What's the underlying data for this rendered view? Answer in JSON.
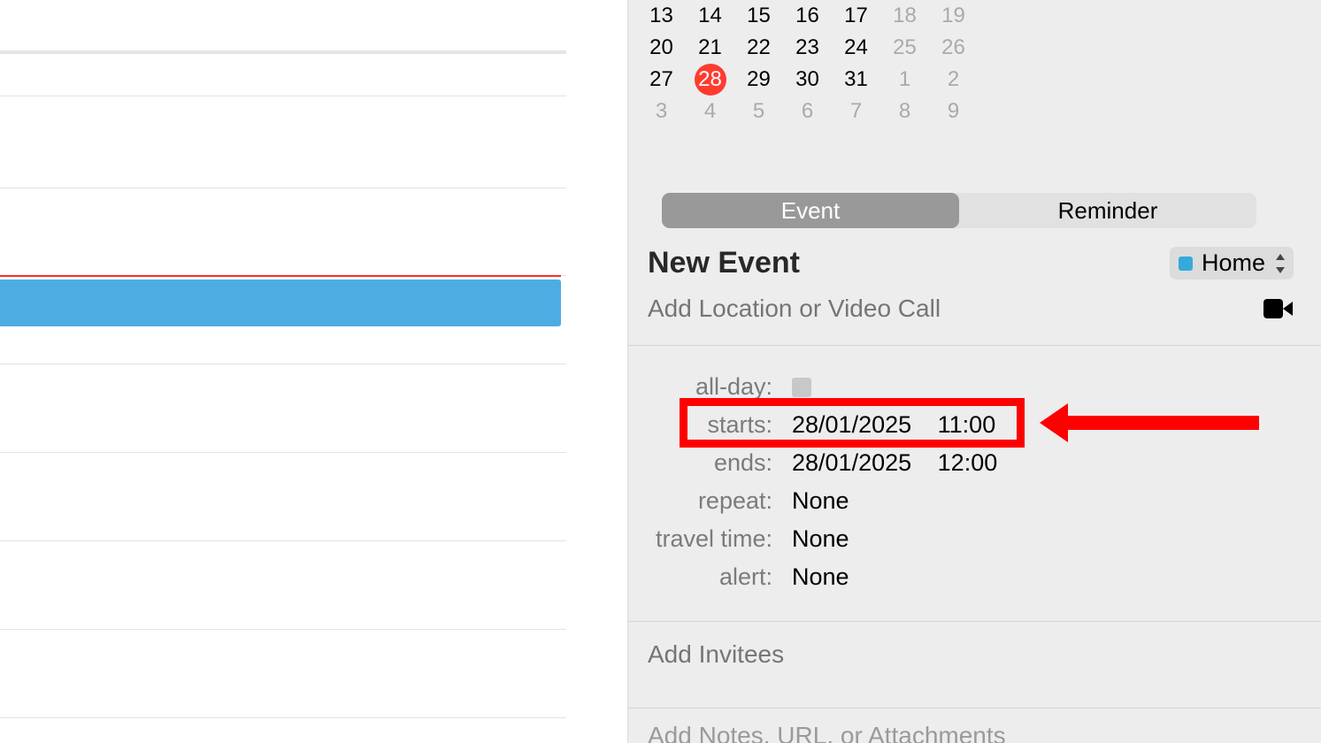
{
  "calendar_grid": {
    "rows": [
      {
        "days": [
          "13",
          "14",
          "15",
          "16",
          "17",
          "18",
          "19"
        ],
        "muted": [
          false,
          false,
          false,
          false,
          false,
          true,
          true
        ]
      },
      {
        "days": [
          "20",
          "21",
          "22",
          "23",
          "24",
          "25",
          "26"
        ],
        "muted": [
          false,
          false,
          false,
          false,
          false,
          true,
          true
        ]
      },
      {
        "days": [
          "27",
          "28",
          "29",
          "30",
          "31",
          "1",
          "2"
        ],
        "muted": [
          false,
          false,
          false,
          false,
          false,
          true,
          true
        ],
        "today_index": 1
      },
      {
        "days": [
          "3",
          "4",
          "5",
          "6",
          "7",
          "8",
          "9"
        ],
        "muted": [
          true,
          true,
          true,
          true,
          true,
          true,
          true
        ]
      }
    ]
  },
  "segmented": {
    "event": "Event",
    "reminder": "Reminder",
    "selected": "event"
  },
  "event_title": "New Event",
  "calendar_select": {
    "name": "Home",
    "color": "#34aadc"
  },
  "location_placeholder": "Add Location or Video Call",
  "details": {
    "allday_label": "all-day:",
    "allday_checked": false,
    "starts_label": "starts:",
    "starts_date": "28/01/2025",
    "starts_time": "11:00",
    "ends_label": "ends:",
    "ends_date": "28/01/2025",
    "ends_time": "12:00",
    "repeat_label": "repeat:",
    "repeat_value": "None",
    "travel_label": "travel time:",
    "travel_value": "None",
    "alert_label": "alert:",
    "alert_value": "None"
  },
  "invitees_placeholder": "Add Invitees",
  "notes_placeholder_partial": "Add Notes, URL, or Attachments",
  "annotation": {
    "target": "starts_row",
    "shape": "red_box_with_left_arrow"
  }
}
